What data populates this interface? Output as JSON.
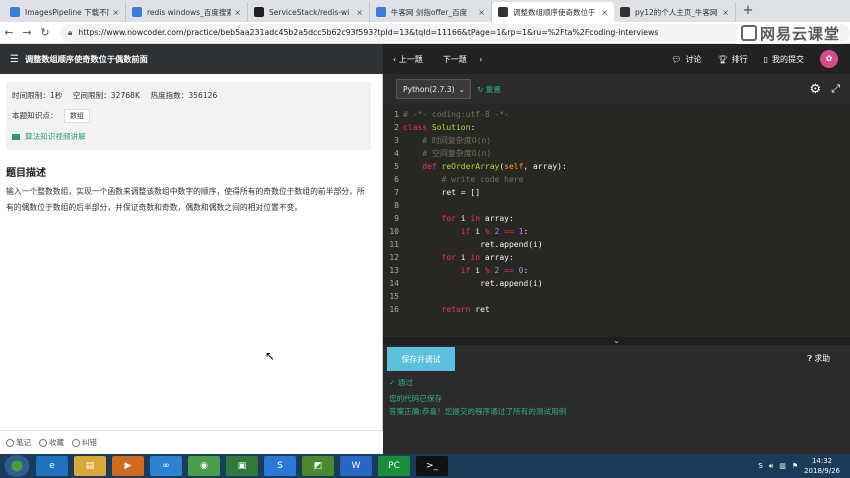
{
  "browser": {
    "tabs": [
      {
        "label": "ImagesPipeline 下载不同",
        "favicon_color": "#3b7ddd",
        "active": false
      },
      {
        "label": "redis windows_百度搜索",
        "favicon_color": "#3b7ddd",
        "active": false
      },
      {
        "label": "ServiceStack/redis-wi",
        "favicon_color": "#222222",
        "active": false
      },
      {
        "label": "牛客网 剑指offer_百度",
        "favicon_color": "#3b7ddd",
        "active": false
      },
      {
        "label": "调整数组顺序使奇数位于",
        "favicon_color": "#333333",
        "active": true
      },
      {
        "label": "py12的个人主页_牛客网",
        "favicon_color": "#333333",
        "active": false
      }
    ],
    "newtab_label": "+",
    "url": "https://www.nowcoder.com/practice/beb5aa231adc45b2a5dcc5b62c93f593?tpId=13&tqId=11166&tPage=1&rp=1&ru=%2Fta%2Fcoding-interviews",
    "watermark": "网易云课堂"
  },
  "left_header": {
    "title": "调整数组顺序使奇数位于偶数前面"
  },
  "right_header": {
    "prev": "上一题",
    "next": "下一题",
    "nav": [
      {
        "icon": "chat-icon",
        "label": "讨论"
      },
      {
        "icon": "trophy-icon",
        "label": "排行"
      },
      {
        "icon": "document-icon",
        "label": "我的提交"
      }
    ]
  },
  "info": {
    "time_limit": "时间限制：1秒",
    "memory_limit": "空间限制：32768K",
    "heat": "热度指数：356126",
    "knowledge_label": "本题知识点：",
    "knowledge_tag": "数组",
    "video_link": "算法知识视频讲解"
  },
  "problem": {
    "title": "题目描述",
    "description": "输入一个整数数组，实现一个函数来调整该数组中数字的顺序，使得所有的奇数位于数组的前半部分，所有的偶数位于数组的后半部分，并保证奇数和奇数，偶数和偶数之间的相对位置不变。"
  },
  "footer_actions": [
    {
      "icon": "note-icon",
      "label": "笔记"
    },
    {
      "icon": "star-icon",
      "label": "收藏"
    },
    {
      "icon": "report-icon",
      "label": "纠错"
    }
  ],
  "editor": {
    "language": "Python(2.7.3)",
    "reset_label": "重置"
  },
  "code_lines": [
    {
      "n": "1",
      "parts": [
        {
          "c": "cm",
          "t": "# -*- coding:utf-8 -*-"
        }
      ]
    },
    {
      "n": "2",
      "parts": [
        {
          "c": "kw",
          "t": "class "
        },
        {
          "c": "fn",
          "t": "Solution"
        },
        {
          "c": "tx",
          "t": ":"
        }
      ]
    },
    {
      "n": "3",
      "parts": [
        {
          "c": "cm",
          "t": "    # 时间复杂度O(n)"
        }
      ]
    },
    {
      "n": "4",
      "parts": [
        {
          "c": "cm",
          "t": "    # 空间复杂度O(n)"
        }
      ]
    },
    {
      "n": "5",
      "parts": [
        {
          "c": "kw",
          "t": "    def "
        },
        {
          "c": "fn",
          "t": "reOrderArray"
        },
        {
          "c": "tx",
          "t": "("
        },
        {
          "c": "sf",
          "t": "self"
        },
        {
          "c": "tx",
          "t": ", array):"
        }
      ]
    },
    {
      "n": "6",
      "parts": [
        {
          "c": "cm",
          "t": "        # write code here"
        }
      ]
    },
    {
      "n": "7",
      "parts": [
        {
          "c": "tx",
          "t": "        ret = []"
        }
      ]
    },
    {
      "n": "8",
      "parts": [
        {
          "c": "tx",
          "t": ""
        }
      ]
    },
    {
      "n": "9",
      "parts": [
        {
          "c": "kw",
          "t": "        for "
        },
        {
          "c": "tx",
          "t": "i "
        },
        {
          "c": "kw",
          "t": "in "
        },
        {
          "c": "tx",
          "t": "array:"
        }
      ]
    },
    {
      "n": "10",
      "parts": [
        {
          "c": "kw",
          "t": "            if "
        },
        {
          "c": "tx",
          "t": "i "
        },
        {
          "c": "kw",
          "t": "% "
        },
        {
          "c": "nm",
          "t": "2 "
        },
        {
          "c": "kw",
          "t": "== "
        },
        {
          "c": "nm",
          "t": "1"
        },
        {
          "c": "tx",
          "t": ":"
        }
      ]
    },
    {
      "n": "11",
      "parts": [
        {
          "c": "tx",
          "t": "                ret.append(i)"
        }
      ]
    },
    {
      "n": "12",
      "parts": [
        {
          "c": "kw",
          "t": "        for "
        },
        {
          "c": "tx",
          "t": "i "
        },
        {
          "c": "kw",
          "t": "in "
        },
        {
          "c": "tx",
          "t": "array:"
        }
      ]
    },
    {
      "n": "13",
      "parts": [
        {
          "c": "kw",
          "t": "            if "
        },
        {
          "c": "tx",
          "t": "i "
        },
        {
          "c": "kw",
          "t": "% "
        },
        {
          "c": "nm",
          "t": "2 "
        },
        {
          "c": "kw",
          "t": "== "
        },
        {
          "c": "nm",
          "t": "0"
        },
        {
          "c": "tx",
          "t": ":"
        }
      ]
    },
    {
      "n": "14",
      "parts": [
        {
          "c": "tx",
          "t": "                ret.append(i)"
        }
      ]
    },
    {
      "n": "15",
      "parts": [
        {
          "c": "tx",
          "t": ""
        }
      ]
    },
    {
      "n": "16",
      "parts": [
        {
          "c": "kw",
          "t": "        return "
        },
        {
          "c": "tx",
          "t": "ret"
        }
      ]
    }
  ],
  "console": {
    "run_label": "保存并调试",
    "help_label": "求助",
    "status_pass": "通过",
    "saved_msg": "您的代码已保存",
    "result_msg": "答案正确:恭喜！您提交的程序通过了所有的测试用例"
  },
  "taskbar": {
    "apps": [
      {
        "icon": "ie-icon",
        "color": "#1e73be",
        "glyph": "e"
      },
      {
        "icon": "folder-icon",
        "color": "#d9a73a",
        "glyph": "▤"
      },
      {
        "icon": "media-icon",
        "color": "#d06a1d",
        "glyph": "▶"
      },
      {
        "icon": "baidu-netdisk-icon",
        "color": "#2c83d3",
        "glyph": "∞"
      },
      {
        "icon": "chrome-icon",
        "color": "#4aa04a",
        "glyph": "◉"
      },
      {
        "icon": "screen-recorder-icon",
        "color": "#2e7a3e",
        "glyph": "▣"
      },
      {
        "icon": "sogou-icon",
        "color": "#2a7ad5",
        "glyph": "S"
      },
      {
        "icon": "image-viewer-icon",
        "color": "#4b8b2f",
        "glyph": "◩"
      },
      {
        "icon": "wps-icon",
        "color": "#2a66c8",
        "glyph": "W"
      },
      {
        "icon": "pycharm-icon",
        "color": "#1a8f3a",
        "glyph": "PC"
      },
      {
        "icon": "terminal-icon",
        "color": "#111111",
        "glyph": ">_"
      }
    ],
    "time": "14:32",
    "date": "2018/9/26"
  }
}
